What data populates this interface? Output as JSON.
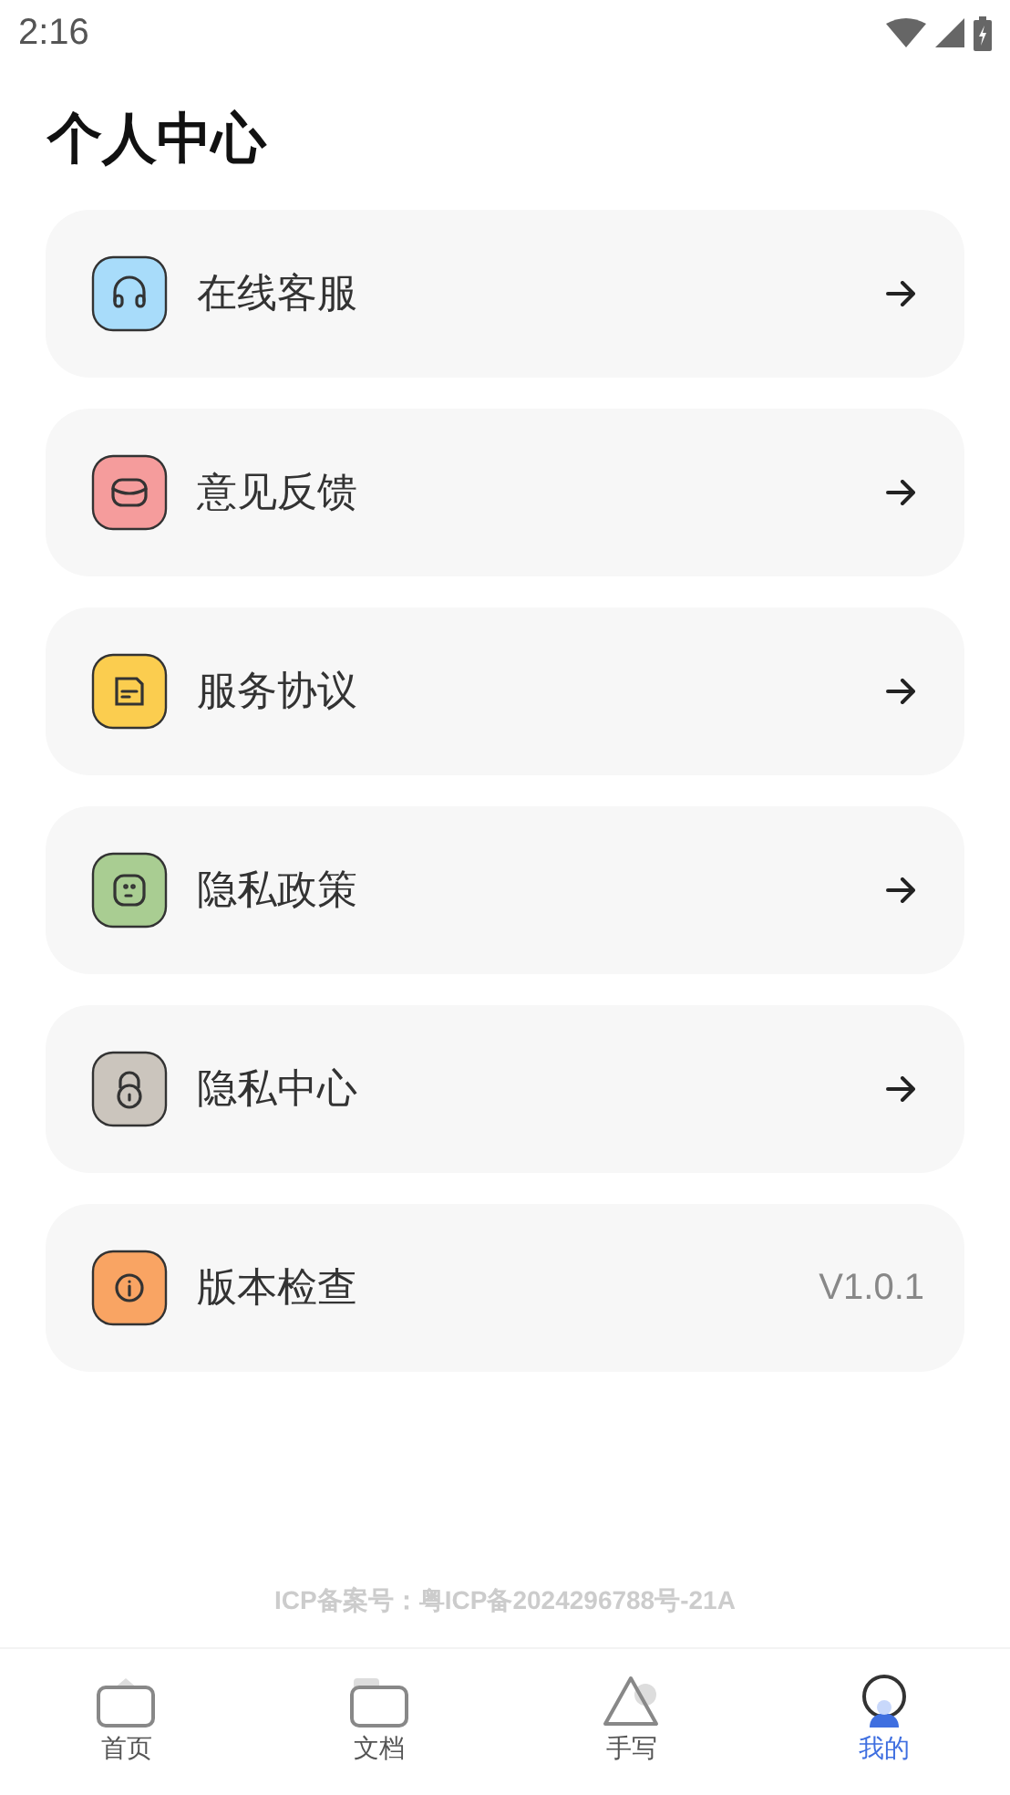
{
  "status_bar": {
    "time": "2:16"
  },
  "title": "个人中心",
  "menu": [
    {
      "label": "在线客服",
      "kind": "arrow",
      "color": "#a8dcfa"
    },
    {
      "label": "意见反馈",
      "kind": "arrow",
      "color": "#f59c9c"
    },
    {
      "label": "服务协议",
      "kind": "arrow",
      "color": "#fbcd4f"
    },
    {
      "label": "隐私政策",
      "kind": "arrow",
      "color": "#a9cd92"
    },
    {
      "label": "隐私中心",
      "kind": "arrow",
      "color": "#cbc5bd"
    },
    {
      "label": "版本检查",
      "kind": "version",
      "value": "V1.0.1",
      "color": "#f9a463"
    }
  ],
  "footer": "ICP备案号：粤ICP备2024296788号-21A",
  "tabs": [
    {
      "label": "首页",
      "selected": false
    },
    {
      "label": "文档",
      "selected": false
    },
    {
      "label": "手写",
      "selected": false
    },
    {
      "label": "我的",
      "selected": true
    }
  ]
}
